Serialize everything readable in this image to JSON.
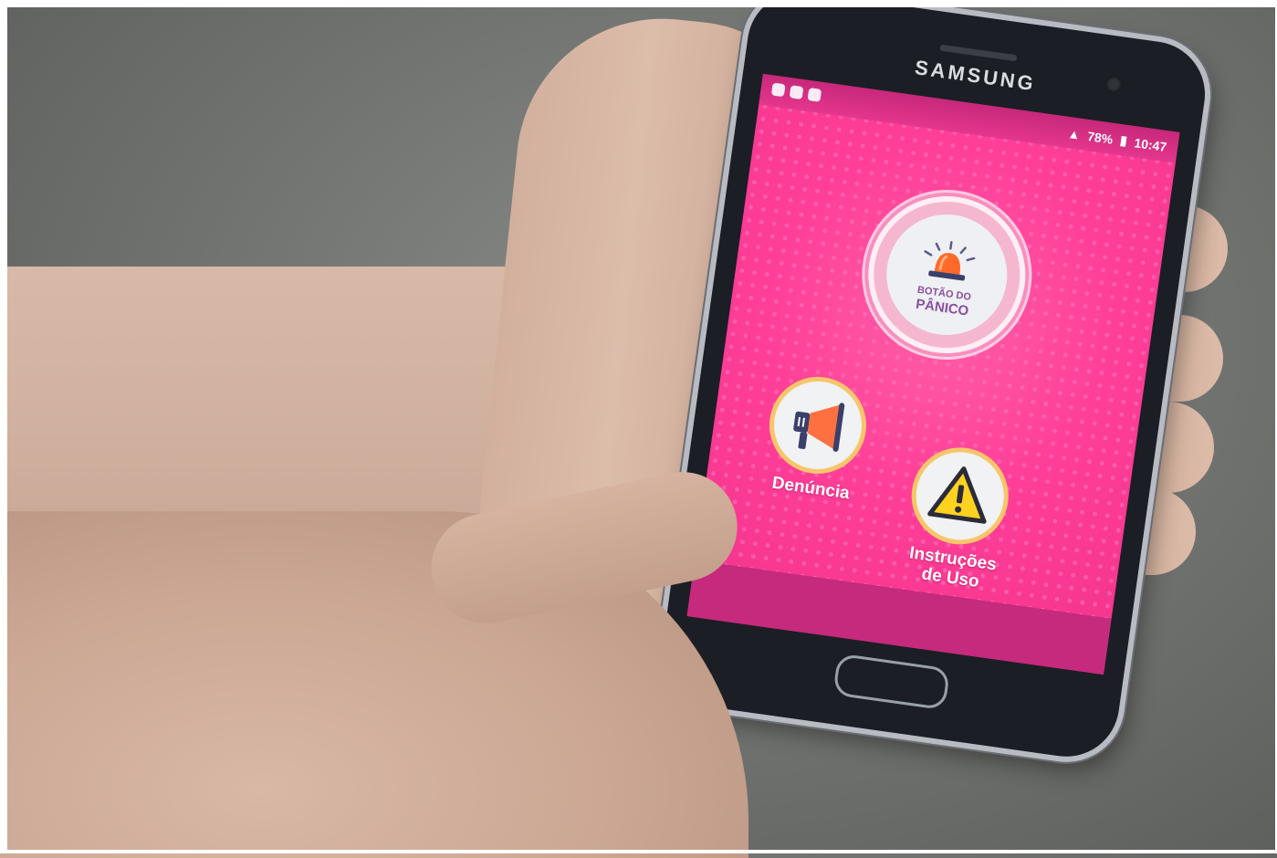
{
  "phone": {
    "brand": "SAMSUNG",
    "status": {
      "battery": "78%",
      "time": "10:47"
    }
  },
  "app": {
    "panic_button": {
      "line1": "BOTÃO DO",
      "line2": "PÂNICO"
    },
    "denuncia_label": "Denúncia",
    "instrucoes_label_line1": "Instruções",
    "instrucoes_label_line2": "de Uso"
  },
  "colors": {
    "screen_pink": "#ff3e98",
    "button_ring": "#f7c66a",
    "bottom_bar": "#c62a7d"
  }
}
